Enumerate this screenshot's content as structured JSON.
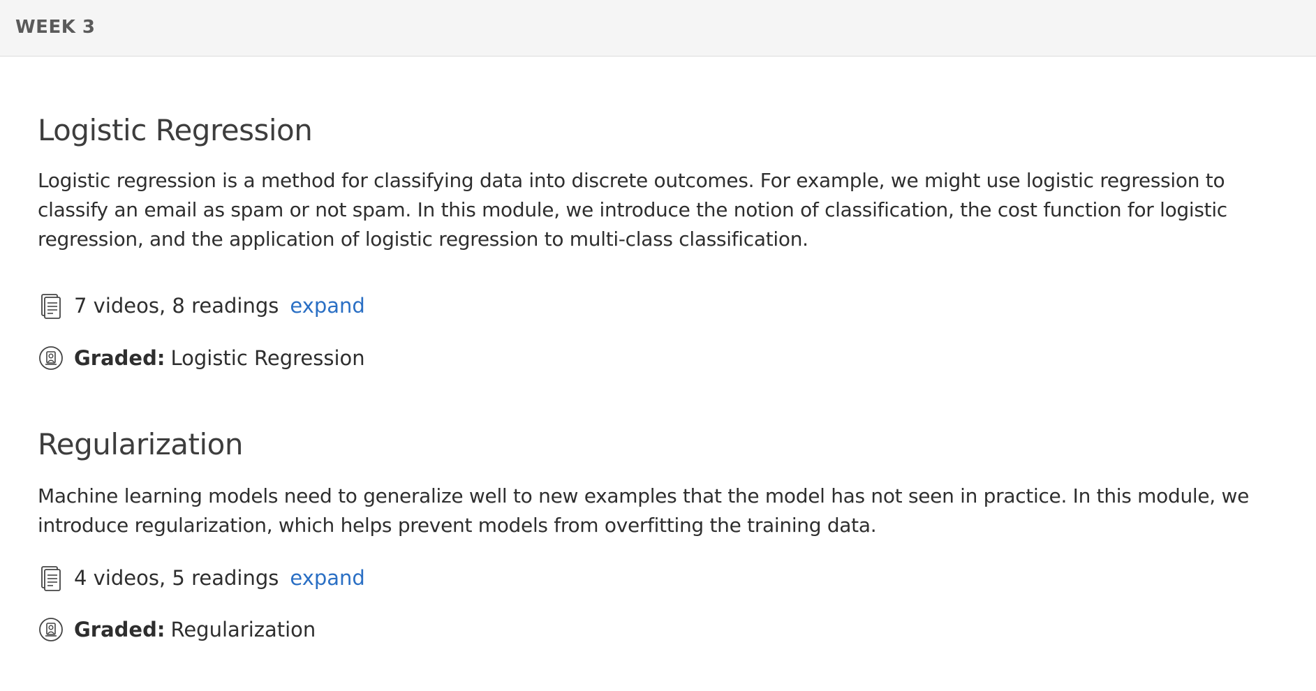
{
  "week": {
    "label": "WEEK 3"
  },
  "modules": [
    {
      "title": "Logistic Regression",
      "description": "Logistic regression is a method for classifying data into discrete outcomes. For example, we might use logistic regression to classify an email as spam or not spam. In this module, we introduce the notion of classification, the cost function for logistic regression, and the application of logistic regression to multi-class classification.",
      "content_summary": "7 videos, 8 readings",
      "expand_label": "expand",
      "graded_label": "Graded:",
      "graded_item": "Logistic Regression",
      "content_icon": "document-icon",
      "graded_icon": "graded-badge-icon"
    },
    {
      "title": "Regularization",
      "description": "Machine learning models need to generalize well to new examples that the model has not seen in practice. In this module, we introduce regularization, which helps prevent models from overfitting the training data.",
      "content_summary": "4 videos, 5 readings",
      "expand_label": "expand",
      "graded_label": "Graded:",
      "graded_item": "Regularization",
      "content_icon": "document-icon",
      "graded_icon": "graded-badge-icon"
    }
  ],
  "colors": {
    "link": "#2a6fc4",
    "header_bg": "#f5f5f5",
    "text": "#2e2e2e"
  }
}
